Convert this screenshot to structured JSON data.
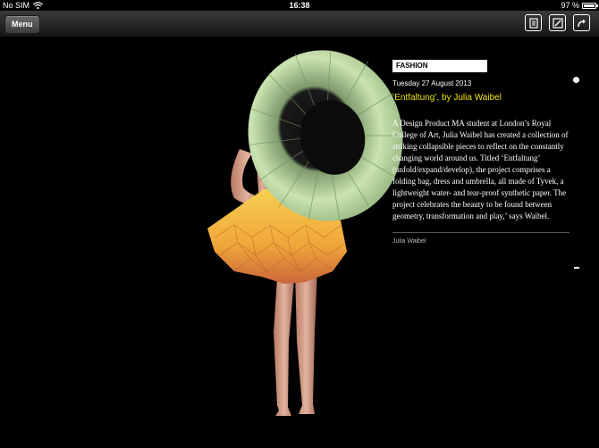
{
  "status_bar": {
    "carrier": "No SIM",
    "time": "16:38",
    "battery_percent": "97 %",
    "battery_level": 0.97,
    "wifi_icon": "wifi-icon",
    "battery_icon": "battery-icon"
  },
  "nav": {
    "menu_label": "Menu",
    "icons": [
      "reader-icon",
      "notes-icon",
      "share-icon"
    ]
  },
  "article": {
    "category": "FASHION",
    "date": "Tuesday 27 August 2013",
    "title": "‘Entfaltung’, by Julia Waibel",
    "body": "A Design Product MA student at London’s Royal College of Art, Julia Waibel has created a collection of striking collapsible pieces to reflect on the constantly changing world around us. Titled ‘Entfaltung’ (unfold/expand/develop), the project comprises a folding bag, dress and umbrella, all made of Tyvek, a lightweight water- and tear-proof synthetic paper. The project celebrates the beauty to be found between geometry, transformation and play,’ says Waibel.",
    "credit": "Julia Waibel"
  },
  "colors": {
    "background": "#000000",
    "title": "#f0e600",
    "fan": "#c9e3b0",
    "skirt": "#f2b43a"
  }
}
